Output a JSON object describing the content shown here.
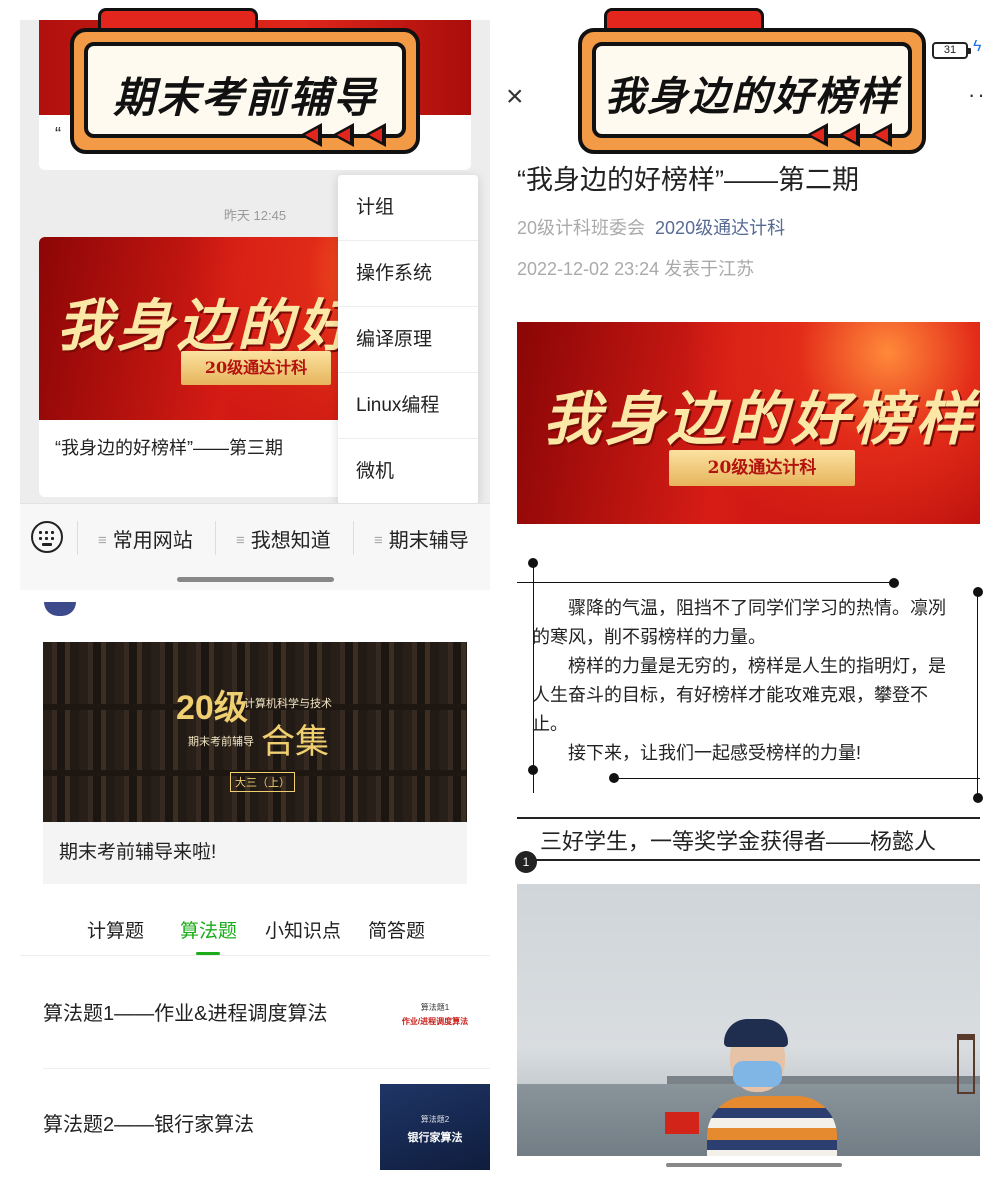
{
  "left_top": {
    "sticker_text": "期末考前辅导",
    "top_card_quote": "“",
    "timestamp": "昨天 12:45",
    "card2": {
      "banner_calligraphy": "我身边的好",
      "banner_ribbon": "20级通达计科",
      "title": "“我身边的好榜样”——第三期"
    },
    "popup_menu": [
      "计组",
      "操作系统",
      "编译原理",
      "Linux编程",
      "微机"
    ],
    "bottom_menu": [
      {
        "label": "常用网站"
      },
      {
        "label": "我想知道"
      },
      {
        "label": "期末辅导"
      }
    ],
    "keyboard_icon": "keyboard-icon"
  },
  "left_bottom": {
    "collection_image": {
      "big": "20级",
      "sub1": "计算机科学与技术",
      "sub2": "期末考前辅导",
      "heji": "合集",
      "tag": "大三（上）"
    },
    "collection_caption": "期末考前辅导来啦!",
    "tabs": [
      {
        "label": "计算题",
        "active": false
      },
      {
        "label": "算法题",
        "active": true
      },
      {
        "label": "小知识点",
        "active": false
      },
      {
        "label": "简答题",
        "active": false
      }
    ],
    "list": [
      {
        "title": "算法题1——作业&进程调度算法",
        "thumb_line1": "算法题1",
        "thumb_line2": "作业/进程调度算法"
      },
      {
        "title": "算法题2——银行家算法",
        "thumb_line1": "算法题2",
        "thumb_line2": "银行家算法"
      }
    ],
    "accent_color": "#1aad19"
  },
  "right": {
    "sticker_text": "我身边的好榜样",
    "status": {
      "battery": "31"
    },
    "article": {
      "title": "“我身边的好榜样”——第二期",
      "author": "20级计科班委会",
      "account": "2020级通达计科",
      "date_location": "2022-12-02 23:24  发表于江苏"
    },
    "banner": {
      "calligraphy": "我身边的好榜样",
      "ribbon": "20级通达计科"
    },
    "paragraphs": [
      "骤降的气温，阻挡不了同学们学习的热情。凛冽的寒风，削不弱榜样的力量。",
      "榜样的力量是无穷的，榜样是人生的指明灯，是人生奋斗的目标，有好榜样才能攻难克艰，攀登不止。",
      "接下来，让我们一起感受榜样的力量!"
    ],
    "section_title": "三好学生，一等奖学金获得者——杨懿人",
    "section_number": "1",
    "link_color": "#576b95"
  }
}
